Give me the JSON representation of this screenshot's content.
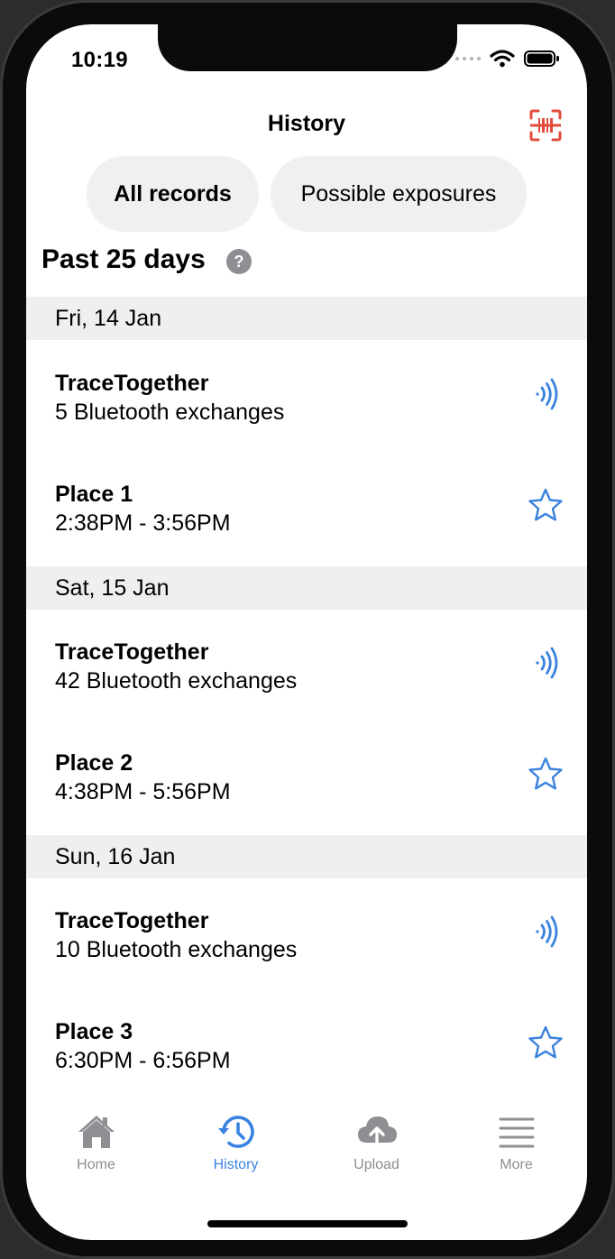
{
  "status_bar": {
    "time": "10:19"
  },
  "header": {
    "title": "History"
  },
  "segments": {
    "all": "All records",
    "possible": "Possible exposures"
  },
  "section": {
    "title": "Past 25 days",
    "help": "?"
  },
  "days": [
    {
      "date": "Fri, 14 Jan",
      "records": [
        {
          "title": "TraceTogether",
          "sub": "5 Bluetooth exchanges",
          "icon": "bluetooth-waves-icon"
        },
        {
          "title": "Place 1",
          "sub": "2:38PM - 3:56PM",
          "icon": "star-icon"
        }
      ]
    },
    {
      "date": "Sat, 15 Jan",
      "records": [
        {
          "title": "TraceTogether",
          "sub": "42 Bluetooth exchanges",
          "icon": "bluetooth-waves-icon"
        },
        {
          "title": "Place 2",
          "sub": "4:38PM - 5:56PM",
          "icon": "star-icon"
        }
      ]
    },
    {
      "date": "Sun, 16 Jan",
      "records": [
        {
          "title": "TraceTogether",
          "sub": "10 Bluetooth exchanges",
          "icon": "bluetooth-waves-icon"
        },
        {
          "title": "Place 3",
          "sub": "6:30PM - 6:56PM",
          "icon": "star-icon"
        }
      ]
    }
  ],
  "tabs": [
    {
      "label": "Home",
      "icon": "home-icon"
    },
    {
      "label": "History",
      "icon": "history-icon",
      "active": true
    },
    {
      "label": "Upload",
      "icon": "cloud-upload-icon"
    },
    {
      "label": "More",
      "icon": "menu-icon"
    }
  ],
  "colors": {
    "accent": "#3a82e0",
    "scan": "#e34b3c",
    "inactive": "#8e8e93",
    "day_header_bg": "#efefef"
  }
}
